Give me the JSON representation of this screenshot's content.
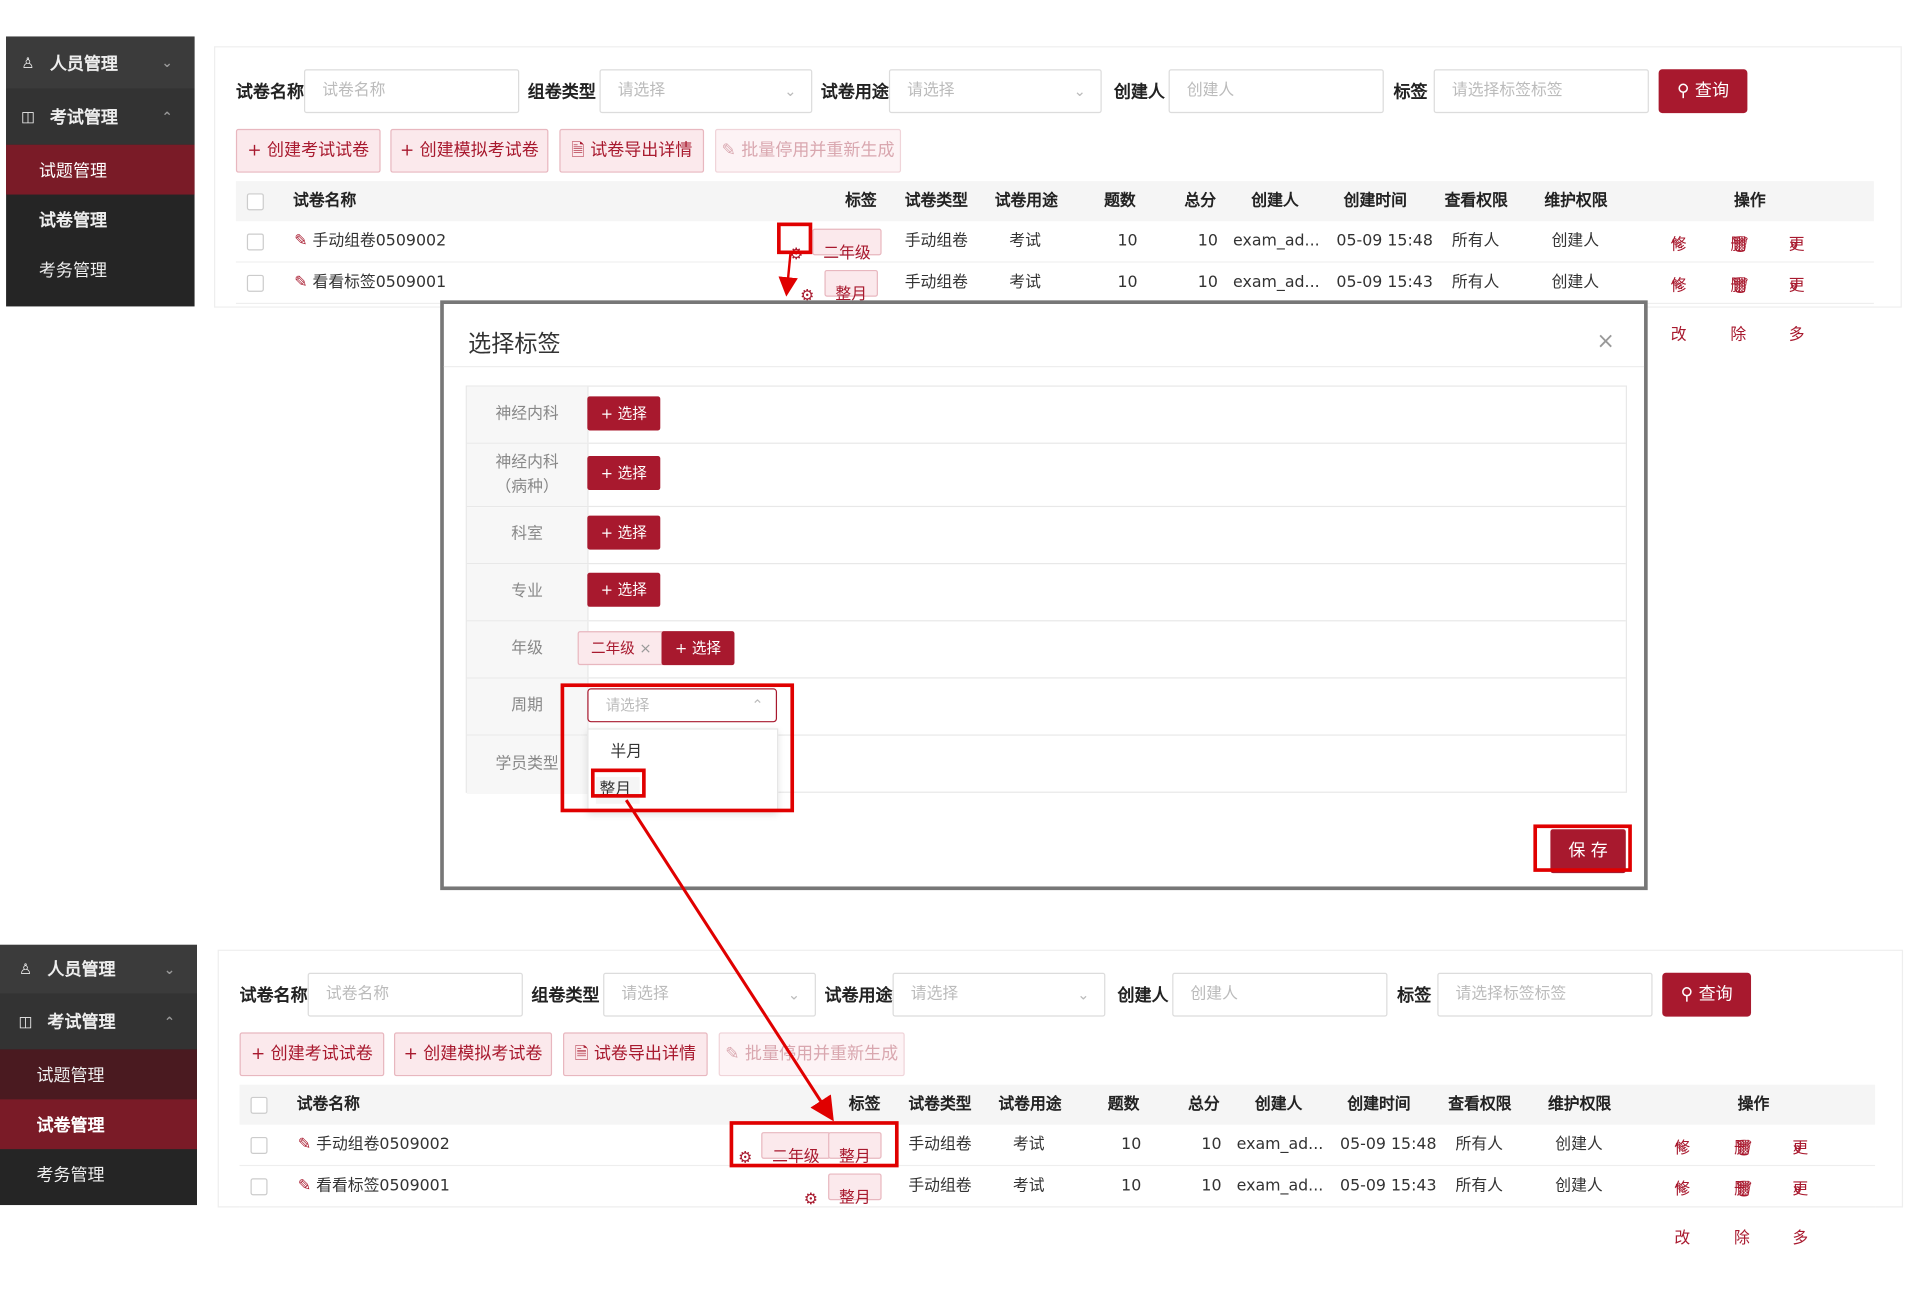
{
  "sidebar": {
    "people_mgmt": "人员管理",
    "exam_mgmt": "考试管理",
    "question_mgmt": "试题管理",
    "paper_mgmt": "试卷管理",
    "affairs_mgmt": "考务管理"
  },
  "filters": {
    "paper_name_label": "试卷名称",
    "paper_name_placeholder": "试卷名称",
    "compose_type_label": "组卷类型",
    "compose_type_placeholder": "请选择",
    "paper_use_label": "试卷用途",
    "paper_use_placeholder": "请选择",
    "creator_label": "创建人",
    "creator_placeholder": "创建人",
    "tag_label": "标签",
    "tag_placeholder": "请选择标签标签",
    "query_button": "查询"
  },
  "toolbar": {
    "create_exam": "+ 创建考试试卷",
    "create_mock": "+ 创建模拟考试卷",
    "export": "试卷导出详情",
    "batch_disable": "批量停用并重新生成"
  },
  "table": {
    "headers": [
      "试卷名称",
      "标签",
      "试卷类型",
      "试卷用途",
      "题数",
      "总分",
      "创建人",
      "创建时间",
      "查看权限",
      "维护权限",
      "操作"
    ],
    "rows_before": [
      {
        "name": "手动组卷0509002",
        "tags": [
          "二年级"
        ],
        "type": "手动组卷",
        "use": "考试",
        "count": "10",
        "score": "10",
        "creator": "exam_ad...",
        "time": "05-09 15:48",
        "view": "所有人",
        "maintain": "创建人"
      },
      {
        "name": "看看标签0509001",
        "tags": [
          "整月"
        ],
        "type": "手动组卷",
        "use": "考试",
        "count": "10",
        "score": "10",
        "creator": "exam_ad...",
        "time": "05-09 15:43",
        "view": "所有人",
        "maintain": "创建人"
      }
    ],
    "rows_after": [
      {
        "name": "手动组卷0509002",
        "tags": [
          "二年级",
          "整月"
        ],
        "type": "手动组卷",
        "use": "考试",
        "count": "10",
        "score": "10",
        "creator": "exam_ad...",
        "time": "05-09 15:48",
        "view": "所有人",
        "maintain": "创建人"
      },
      {
        "name": "看看标签0509001",
        "tags": [
          "整月"
        ],
        "type": "手动组卷",
        "use": "考试",
        "count": "10",
        "score": "10",
        "creator": "exam_ad...",
        "time": "05-09 15:43",
        "view": "所有人",
        "maintain": "创建人"
      }
    ],
    "op_edit": "修改",
    "op_delete": "删除",
    "op_more": "更多"
  },
  "modal": {
    "title": "选择标签",
    "close": "×",
    "rows": [
      {
        "label": "神经内科"
      },
      {
        "label": "神经内科（病种）"
      },
      {
        "label": "科室"
      },
      {
        "label": "专业"
      },
      {
        "label": "年级",
        "tag": "二年级"
      },
      {
        "label": "周期"
      },
      {
        "label": "学员类型"
      }
    ],
    "select_button": "+ 选择",
    "select_placeholder": "请选择",
    "options": [
      "半月",
      "整月"
    ],
    "save_button": "保 存",
    "tag_remove": "×"
  },
  "colors": {
    "accent": "#a8192e",
    "highlight": "#e00000",
    "sidebar_bg": "#252525",
    "sidebar_active": "#7a1b27"
  },
  "icons": {
    "people": "people-icon",
    "book": "book-icon",
    "gear": "gear-icon",
    "search": "search-icon",
    "edit": "edit-icon",
    "delete": "trash-icon",
    "more": "double-chevron-icon"
  }
}
